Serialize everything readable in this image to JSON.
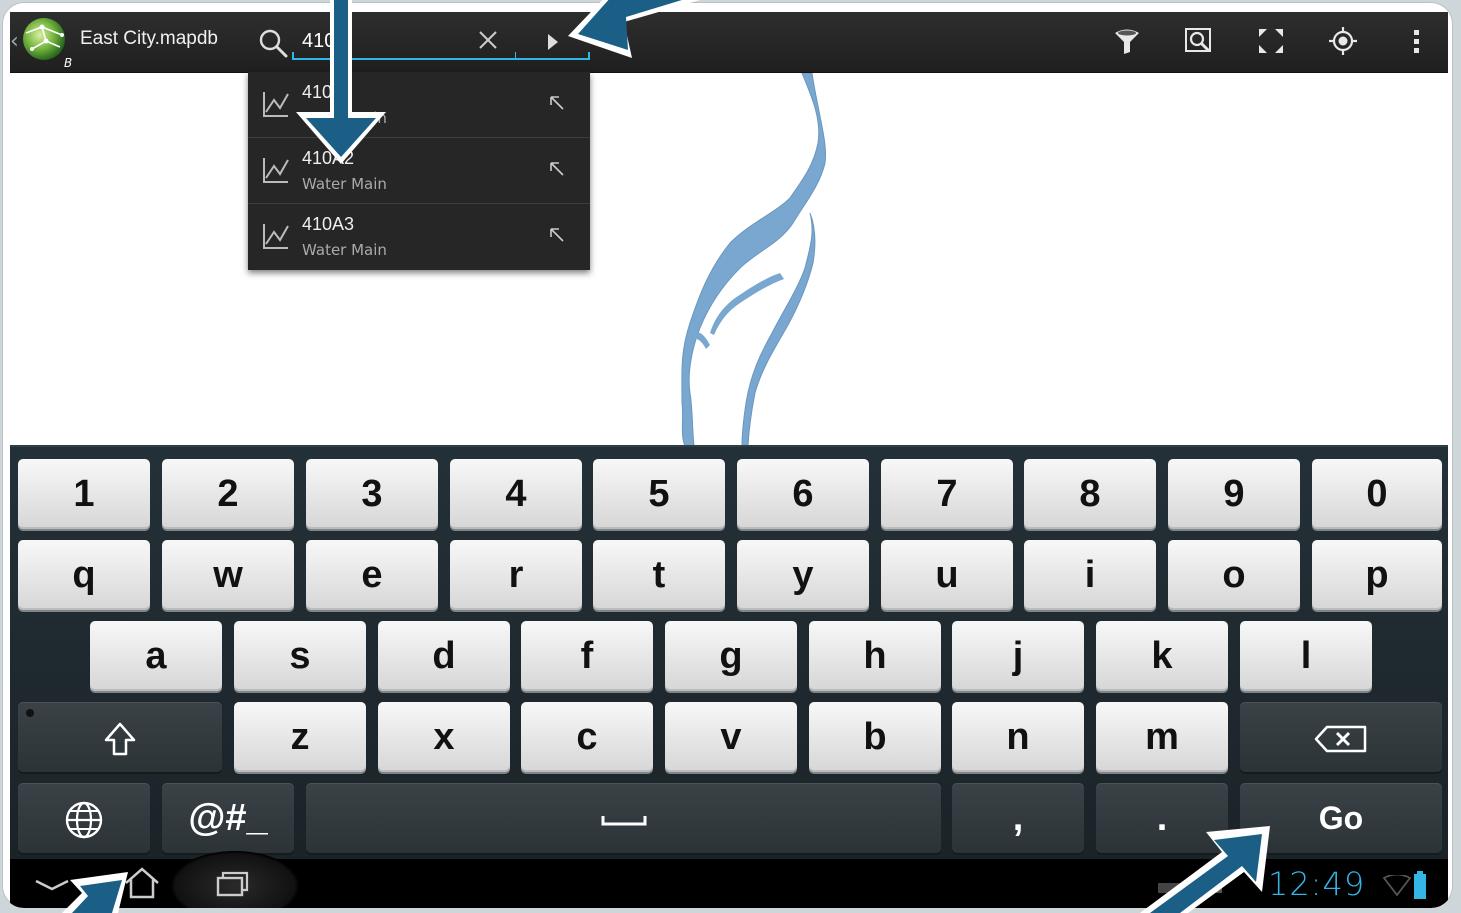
{
  "app": {
    "title": "East City.mapdb",
    "logo_badge": "B"
  },
  "search": {
    "value": "410",
    "placeholder": ""
  },
  "suggestions": [
    {
      "title": "410",
      "subtitle": "Water Main"
    },
    {
      "title": "410A2",
      "subtitle": "Water Main"
    },
    {
      "title": "410A3",
      "subtitle": "Water Main"
    }
  ],
  "actionbar_icons": [
    "filter-icon",
    "zoom-extent-icon",
    "fullscreen-icon",
    "locate-icon",
    "overflow-menu-icon"
  ],
  "keyboard": {
    "row1": [
      "1",
      "2",
      "3",
      "4",
      "5",
      "6",
      "7",
      "8",
      "9",
      "0"
    ],
    "row2": [
      "q",
      "w",
      "e",
      "r",
      "t",
      "y",
      "u",
      "i",
      "o",
      "p"
    ],
    "row3": [
      "a",
      "s",
      "d",
      "f",
      "g",
      "h",
      "j",
      "k",
      "l"
    ],
    "row4": [
      "z",
      "x",
      "c",
      "v",
      "b",
      "n",
      "m"
    ],
    "symbols_label": "@#_",
    "comma_label": ",",
    "period_label": ".",
    "go_label": "Go"
  },
  "status": {
    "time": "12:49"
  },
  "colors": {
    "accent": "#33b5e5",
    "water": "#7aa7cf",
    "annotation_arrow": "#1b5e86"
  }
}
